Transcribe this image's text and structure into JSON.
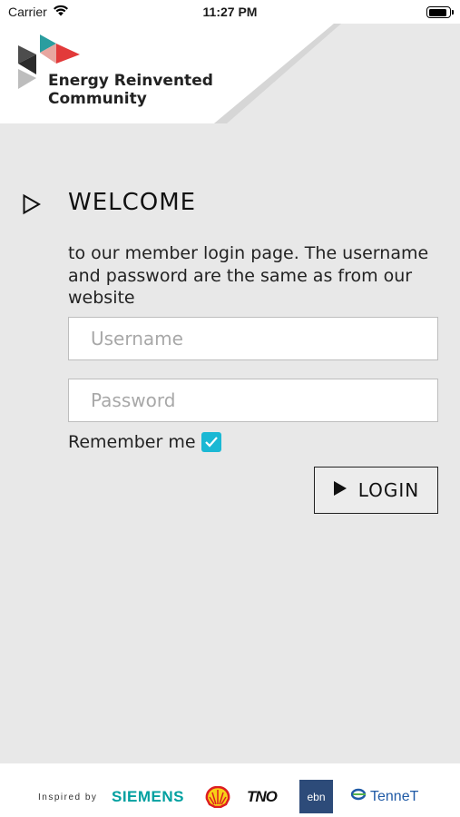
{
  "status_bar": {
    "carrier": "Carrier",
    "time": "11:27 PM",
    "battery_level": 0.9
  },
  "header": {
    "logo_line1": "Energy Reinvented",
    "logo_line2": "Community"
  },
  "welcome": {
    "title": "WELCOME",
    "text": "to our member login page. The username and password are the same as from our website"
  },
  "form": {
    "username_placeholder": "Username",
    "password_placeholder": "Password",
    "remember_label": "Remember me",
    "remember_checked": true,
    "login_label": "LOGIN"
  },
  "footer": {
    "inspired_by": "Inspired by",
    "partners": [
      "SIEMENS",
      "TNO",
      "ebn",
      "TenneT"
    ]
  },
  "colors": {
    "accent_checkbox": "#1bb8d4",
    "background": "#e8e8e8",
    "logo_red": "#e23a3a",
    "logo_teal": "#2a9d9f",
    "logo_dark": "#2b2b2b"
  },
  "icons": {
    "welcome": "play-outline-icon",
    "login": "play-solid-icon",
    "checkbox": "checkmark-icon"
  }
}
